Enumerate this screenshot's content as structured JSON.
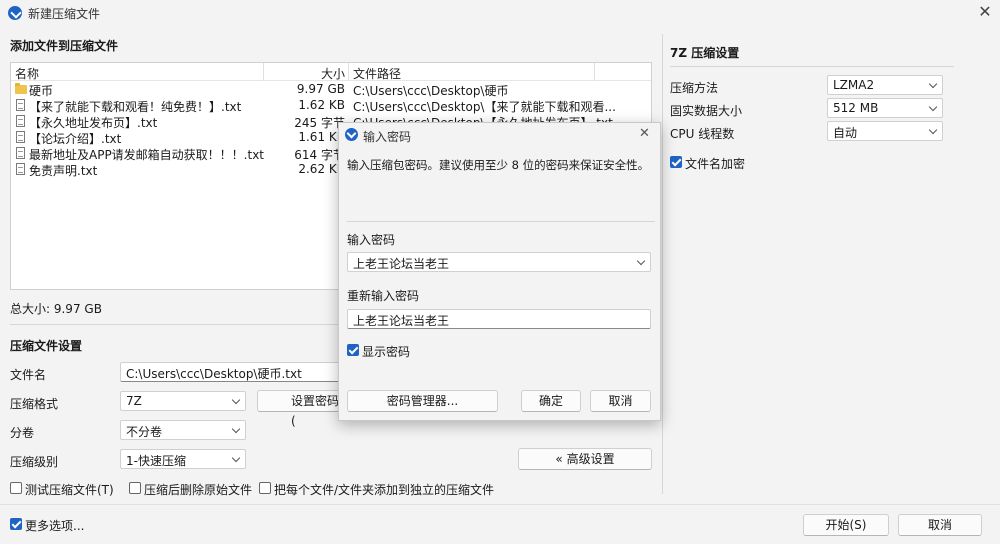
{
  "window": {
    "title": "新建压缩文件",
    "close": "✕"
  },
  "add_section": {
    "title": "添加文件到压缩文件"
  },
  "file_list": {
    "columns": {
      "name": "名称",
      "size": "大小",
      "path": "文件路径"
    },
    "rows": [
      {
        "type": "folder",
        "name": "硬币",
        "size": "9.97 GB",
        "path": "C:\\Users\\ccc\\Desktop\\硬币"
      },
      {
        "type": "file",
        "name": "【来了就能下载和观看！纯免费！】.txt",
        "size": "1.62 KB",
        "path": "C:\\Users\\ccc\\Desktop\\【来了就能下载和观看..."
      },
      {
        "type": "file",
        "name": "【永久地址发布页】.txt",
        "size": "245 字节",
        "path": "C:\\Users\\ccc\\Desktop\\【永久地址发布页】.txt"
      },
      {
        "type": "file",
        "name": "【论坛介绍】.txt",
        "size": "1.61 KB",
        "path": ""
      },
      {
        "type": "file",
        "name": "最新地址及APP请发邮箱自动获取！！！.txt",
        "size": "614 字节",
        "path": ""
      },
      {
        "type": "file",
        "name": "免责声明.txt",
        "size": "2.62 KB",
        "path": ""
      }
    ]
  },
  "total_size": "总大小: 9.97 GB",
  "compress_settings": {
    "title": "压缩文件设置",
    "filename_label": "文件名",
    "filename_value": "C:\\Users\\ccc\\Desktop\\硬币.txt",
    "format_label": "压缩格式",
    "format_value": "7Z",
    "set_password_button": "设置密码(",
    "volume_label": "分卷",
    "volume_value": "不分卷",
    "level_label": "压缩级别",
    "level_value": "1-快速压缩",
    "advanced_button": "« 高级设置",
    "test_checkbox": "测试压缩文件(T)",
    "delete_checkbox": "压缩后删除原始文件",
    "separate_checkbox": "把每个文件/文件夹添加到独立的压缩文件"
  },
  "footer": {
    "more_options": "更多选项...",
    "start_button": "开始(S)",
    "cancel_button": "取消"
  },
  "seven_z": {
    "title": "7Z 压缩设置",
    "method_label": "压缩方法",
    "method_value": "LZMA2",
    "dict_label": "固实数据大小",
    "dict_value": "512 MB",
    "threads_label": "CPU 线程数",
    "threads_value": "自动",
    "encrypt_names": "文件名加密"
  },
  "password_dialog": {
    "title": "输入密码",
    "close": "✕",
    "instruction": "输入压缩包密码。建议使用至少 8 位的密码来保证安全性。",
    "password_label": "输入密码",
    "password_value": "上老王论坛当老王",
    "repeat_label": "重新输入密码",
    "repeat_value": "上老王论坛当老王",
    "show_password": "显示密码",
    "manager_button": "密码管理器...",
    "ok_button": "确定",
    "cancel_button": "取消"
  },
  "colors": {
    "accent": "#1f63c6",
    "background": "#f3f3f3"
  }
}
